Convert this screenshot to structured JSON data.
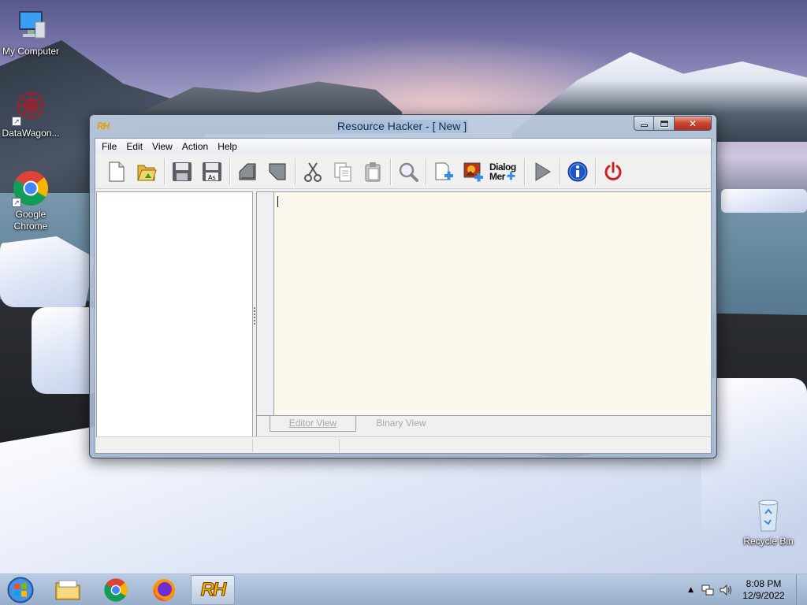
{
  "desktop": {
    "icons": [
      {
        "label": "My Computer",
        "icon": "computer-icon"
      },
      {
        "label": "DataWagon...",
        "icon": "datawagon-icon"
      },
      {
        "label": "Google Chrome",
        "icon": "chrome-icon"
      },
      {
        "label": "Recycle Bin",
        "icon": "recycle-bin-icon"
      }
    ]
  },
  "window": {
    "logo": "RH",
    "title": "Resource Hacker - [ New ]",
    "close_glyph": "✕"
  },
  "menu": {
    "items": [
      "File",
      "Edit",
      "View",
      "Action",
      "Help"
    ]
  },
  "toolbar": {
    "dialog_menu_line1": "Dialog",
    "dialog_menu_line2": "Mer",
    "buttons": [
      "new-file-icon",
      "open-file-icon",
      "save-icon",
      "save-as-icon",
      "back-icon",
      "forward-icon",
      "cut-icon",
      "copy-icon",
      "paste-icon",
      "search-icon",
      "add-blank-resource-icon",
      "add-image-resource-icon",
      "dialog-merge-icon",
      "compile-run-icon",
      "about-info-icon",
      "exit-power-icon"
    ],
    "save_as_text": "As"
  },
  "tabs": {
    "editor": "Editor View",
    "binary": "Binary View"
  },
  "taskbar": {
    "time": "8:08 PM",
    "date": "12/9/2022",
    "active_app_label": "RH"
  },
  "colors": {
    "editor_background": "#fdf8ee",
    "exit_red": "#d0201a",
    "info_blue": "#1c56c4"
  }
}
